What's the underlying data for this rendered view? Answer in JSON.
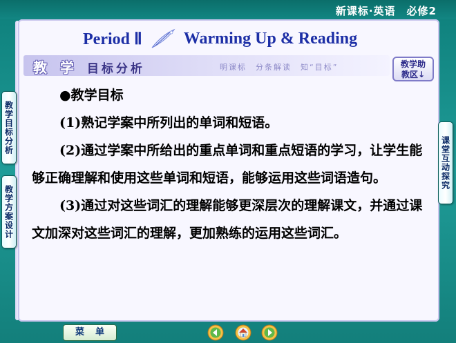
{
  "header": {
    "course_label": "新课标·英语　必修2"
  },
  "lesson": {
    "period": "Period Ⅱ",
    "title": "Warming Up & Reading"
  },
  "section": {
    "title_big": "教 学",
    "title_small": "目标分析",
    "subtitle": "明课标　分条解读　知“目标”",
    "help_line1": "教学助",
    "help_line2": "教区↓"
  },
  "content": {
    "heading": "●教学目标",
    "item1": "(1)熟记学案中所列出的单词和短语。",
    "item2": "(2)通过学案中所给出的重点单词和重点短语的学习，让学生能够正确理解和使用这些单词和短语，能够运用这些词语造句。",
    "item3": "(3)通过对这些词汇的理解能够更深层次的理解课文，并通过课文加深对这些词汇的理解，更加熟练的运用这些词汇。"
  },
  "side_tabs": {
    "left_1": "教学目标分析",
    "left_2": "教学方案设计",
    "right_1": "课堂互动探究"
  },
  "bottom": {
    "menu_label": "菜单"
  },
  "icons": {
    "prev": "prev-arrow-icon",
    "home": "home-icon",
    "next": "next-arrow-icon"
  },
  "colors": {
    "accent_blue": "#1d2fa6",
    "frame_teal": "#1f9c98",
    "card_bg": "#f8f7ff"
  }
}
